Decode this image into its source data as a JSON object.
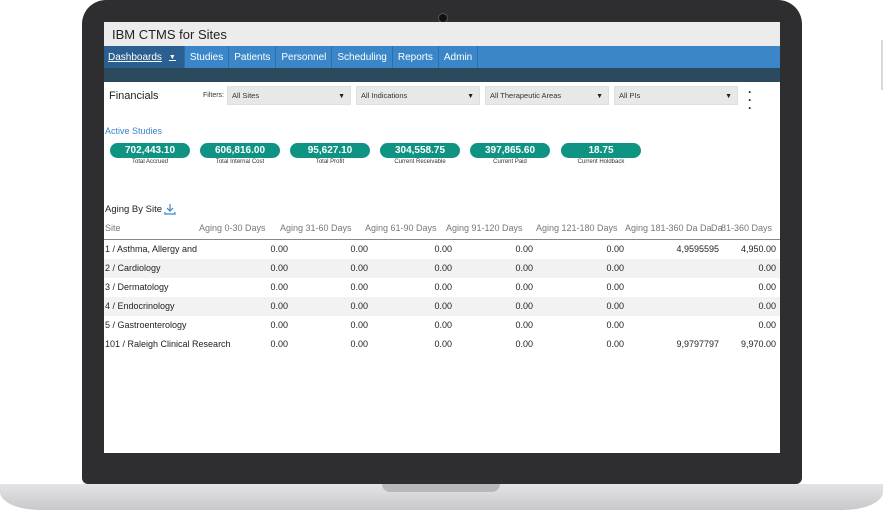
{
  "app": {
    "title": "IBM CTMS for Sites"
  },
  "nav": {
    "items": [
      {
        "label": "Dashboards",
        "active": true
      },
      {
        "label": "Studies"
      },
      {
        "label": "Patients"
      },
      {
        "label": "Personnel"
      },
      {
        "label": "Scheduling"
      },
      {
        "label": "Reports"
      },
      {
        "label": "Admin"
      }
    ]
  },
  "page": {
    "title": "Financials"
  },
  "filters": {
    "label": "Filters:",
    "sites": "All Sites",
    "indications": "All Indications",
    "therapeutic_areas": "All Therapeutic Areas",
    "pis": "All PIs"
  },
  "active_studies": {
    "title": "Active Studies",
    "kpis": [
      {
        "value": "702,443.10",
        "label": "Total Accrued"
      },
      {
        "value": "606,816.00",
        "label": "Total Internal Cost"
      },
      {
        "value": "95,627.10",
        "label": "Total Profit"
      },
      {
        "value": "304,558.75",
        "label": "Current Receivable"
      },
      {
        "value": "397,865.60",
        "label": "Current Paid"
      },
      {
        "value": "18.75",
        "label": "Current Holdback"
      }
    ]
  },
  "aging": {
    "title": "Aging By Site",
    "columns": [
      "Site",
      "Aging 0-30 Days",
      "Aging 31-60 Days",
      "Aging 61-90 Days",
      "Aging 91-120 Days",
      "Aging 121-180 Days",
      "Aging 181-360 Da",
      "Da",
      "Da",
      "81-360 Days"
    ],
    "rows": [
      {
        "site": "1 / Asthma, Allergy and",
        "c1": "0.00",
        "c2": "0.00",
        "c3": "0.00",
        "c4": "0.00",
        "c5": "0.00",
        "c6": "4,9595595",
        "c7": "4,950.00"
      },
      {
        "site": "2 / Cardiology",
        "c1": "0.00",
        "c2": "0.00",
        "c3": "0.00",
        "c4": "0.00",
        "c5": "0.00",
        "c6": "",
        "c7": "0.00"
      },
      {
        "site": "3 / Dermatology",
        "c1": "0.00",
        "c2": "0.00",
        "c3": "0.00",
        "c4": "0.00",
        "c5": "0.00",
        "c6": "",
        "c7": "0.00"
      },
      {
        "site": "4 / Endocrinology",
        "c1": "0.00",
        "c2": "0.00",
        "c3": "0.00",
        "c4": "0.00",
        "c5": "0.00",
        "c6": "",
        "c7": "0.00"
      },
      {
        "site": "5 / Gastroenterology",
        "c1": "0.00",
        "c2": "0.00",
        "c3": "0.00",
        "c4": "0.00",
        "c5": "0.00",
        "c6": "",
        "c7": "0.00"
      },
      {
        "site": "101 / Raleigh Clinical Research",
        "c1": "0.00",
        "c2": "0.00",
        "c3": "0.00",
        "c4": "0.00",
        "c5": "0.00",
        "c6": "9,9797797",
        "c7": "9,970.00"
      }
    ]
  },
  "colors": {
    "nav": "#3a86c8",
    "kpi": "#0f9382",
    "accent_text": "#3a86c8"
  }
}
